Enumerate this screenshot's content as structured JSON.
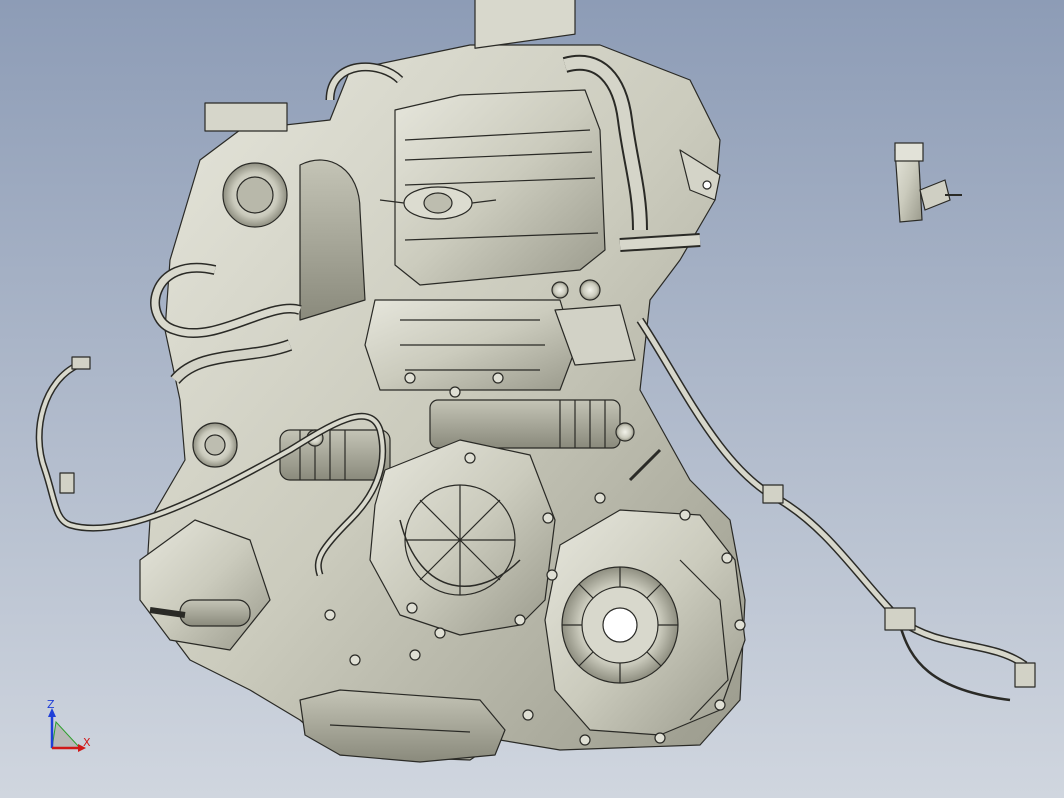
{
  "viewport": {
    "background_top": "#8d9cb6",
    "background_bottom": "#d0d6df",
    "model_fill": "#cfcfc2",
    "model_stroke": "#2a2a26"
  },
  "triad": {
    "z_label": "Z",
    "x_label": "X",
    "z_color": "#1f3fd8",
    "x_color": "#d01818",
    "y_color": "#2ea02e"
  }
}
